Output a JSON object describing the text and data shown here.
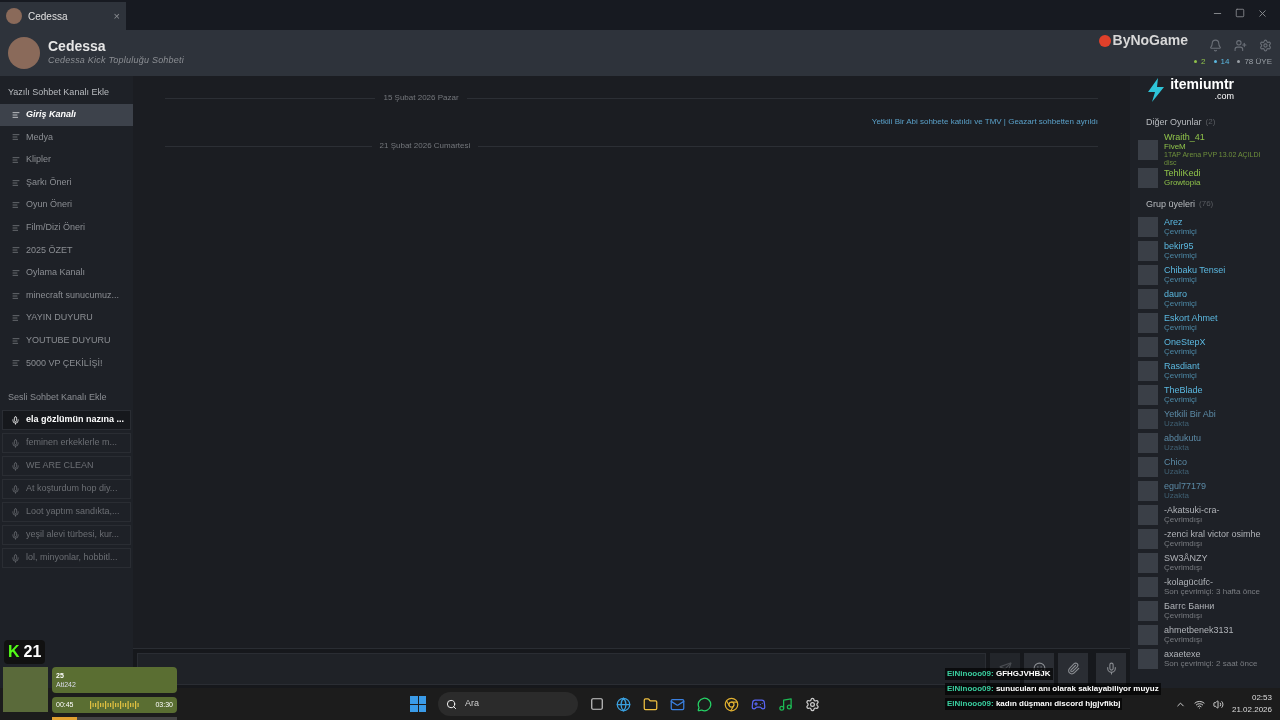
{
  "tab": {
    "title": "Cedessa",
    "close": "×"
  },
  "header": {
    "name": "Cedessa",
    "subtitle": "Cedessa Kick Topluluğu Sohbeti",
    "counts": [
      {
        "text": "2",
        "kind": "ingame"
      },
      {
        "text": "14",
        "kind": "online"
      },
      {
        "text": "78 ÜYE",
        "kind": "total"
      }
    ]
  },
  "text_channels": {
    "heading": "Yazılı Sohbet Kanalı Ekle",
    "items": [
      {
        "name": "Giriş Kanalı",
        "selected": true
      },
      {
        "name": "Medya",
        "selected": false
      },
      {
        "name": "Klipler",
        "selected": false
      },
      {
        "name": "Şarkı Öneri",
        "selected": false
      },
      {
        "name": "Oyun Öneri",
        "selected": false
      },
      {
        "name": "Film/Dizi Öneri",
        "selected": false
      },
      {
        "name": "2025 ÖZET",
        "selected": false
      },
      {
        "name": "Oylama Kanalı",
        "selected": false
      },
      {
        "name": "minecraft sunucumuz...",
        "selected": false
      },
      {
        "name": "YAYIN DUYURU",
        "selected": false
      },
      {
        "name": "YOUTUBE DUYURU",
        "selected": false
      },
      {
        "name": "5000 VP ÇEKİLİŞİ!",
        "selected": false
      }
    ]
  },
  "voice_channels": {
    "heading": "Sesli Sohbet Kanalı Ekle",
    "items": [
      {
        "name": "ela gözlümün nazına ...",
        "selected": true
      },
      {
        "name": "feminen erkeklerle m...",
        "selected": false
      },
      {
        "name": "WE ARE CLEAN",
        "selected": false
      },
      {
        "name": "At koşturdum hop diy...",
        "selected": false
      },
      {
        "name": "Loot yaptım sandıkta,...",
        "selected": false
      },
      {
        "name": "yeşil alevi türbesi, kur...",
        "selected": false
      },
      {
        "name": "lol, minyonlar, hobbitl...",
        "selected": false
      }
    ]
  },
  "chat": {
    "items": [
      {
        "kind": "date",
        "text": "15 Şubat 2026 Pazar"
      },
      {
        "kind": "system",
        "text": "Yetkili Bir Abi sohbete katıldı ve TMV | Geazart sohbetten ayrıldı"
      },
      {
        "kind": "date",
        "text": "21 Şubat 2026 Cumartesi"
      }
    ]
  },
  "members": {
    "sections": [
      {
        "title": "Diğer Oyunlar",
        "count": "(2)",
        "members": [
          {
            "name": "Wraith_41",
            "status": "FiveM",
            "detail": "1TAP Arena PVP 13.02 AÇILDI disc",
            "kind": "ingame"
          },
          {
            "name": "TehliKedi",
            "status": "Growtopia",
            "kind": "ingame"
          }
        ]
      },
      {
        "title": "Grup üyeleri",
        "count": "(76)",
        "members": [
          {
            "name": "Arez",
            "status": "Çevrimiçi",
            "kind": "online"
          },
          {
            "name": "bekir95",
            "status": "Çevrimiçi",
            "kind": "online"
          },
          {
            "name": "Chibaku Tensei",
            "status": "Çevrimiçi",
            "kind": "online"
          },
          {
            "name": "dauro",
            "status": "Çevrimiçi",
            "kind": "online"
          },
          {
            "name": "Eskort Ahmet",
            "status": "Çevrimiçi",
            "kind": "online"
          },
          {
            "name": "OneStepX",
            "status": "Çevrimiçi",
            "kind": "online"
          },
          {
            "name": "Rasdiant",
            "status": "Çevrimiçi",
            "kind": "online"
          },
          {
            "name": "TheBlade",
            "status": "Çevrimiçi",
            "kind": "online"
          },
          {
            "name": "Yetkili Bir Abi",
            "status": "Uzakta",
            "kind": "away"
          },
          {
            "name": "abdukutu",
            "status": "Uzakta",
            "kind": "away"
          },
          {
            "name": "Chico",
            "status": "Uzakta",
            "kind": "away"
          },
          {
            "name": "egul77179",
            "status": "Uzakta",
            "kind": "away"
          },
          {
            "name": "-Akatsuki-cra-",
            "status": "Çevrimdışı",
            "kind": "offline"
          },
          {
            "name": "-zenci kral victor osimhe",
            "status": "Çevrimdışı",
            "kind": "offline"
          },
          {
            "name": "SW3ÅNZY",
            "status": "Çevrimdışı",
            "kind": "offline"
          },
          {
            "name": "-kolagücüfc-",
            "status": "Son çevrimiçi: 3 hafta önce",
            "kind": "offline"
          },
          {
            "name": "Баггс Банни",
            "status": "Çevrimdışı",
            "kind": "offline"
          },
          {
            "name": "ahmetbenek3131",
            "status": "Çevrimdışı",
            "kind": "offline"
          },
          {
            "name": "axaetexe",
            "status": "Son çevrimiçi: 2 saat önce",
            "kind": "offline"
          }
        ]
      }
    ]
  },
  "taskbar": {
    "search": "Ara",
    "time": "02:53",
    "date": "21.02.2026"
  },
  "overlays": {
    "kick_letter": "K",
    "kick_count": "21",
    "logos": [
      {
        "text": "ByNoGame"
      },
      {
        "text": "itemiumtr"
      },
      {
        "text": ".com"
      }
    ],
    "player": {
      "track": "25",
      "artist": "Ati242",
      "elapsed": "00:45",
      "total": "03:30",
      "level": 0.2
    },
    "chat": [
      {
        "user": "ElNinooo09:",
        "text": "GFHGJVHBJK"
      },
      {
        "user": "ElNinooo09:",
        "text": "sunucuları anı olarak saklayabiliyor muyuz"
      },
      {
        "user": "ElNinooo09:",
        "text": "kadın düşmanı discord hjgjvfikbj"
      }
    ]
  }
}
